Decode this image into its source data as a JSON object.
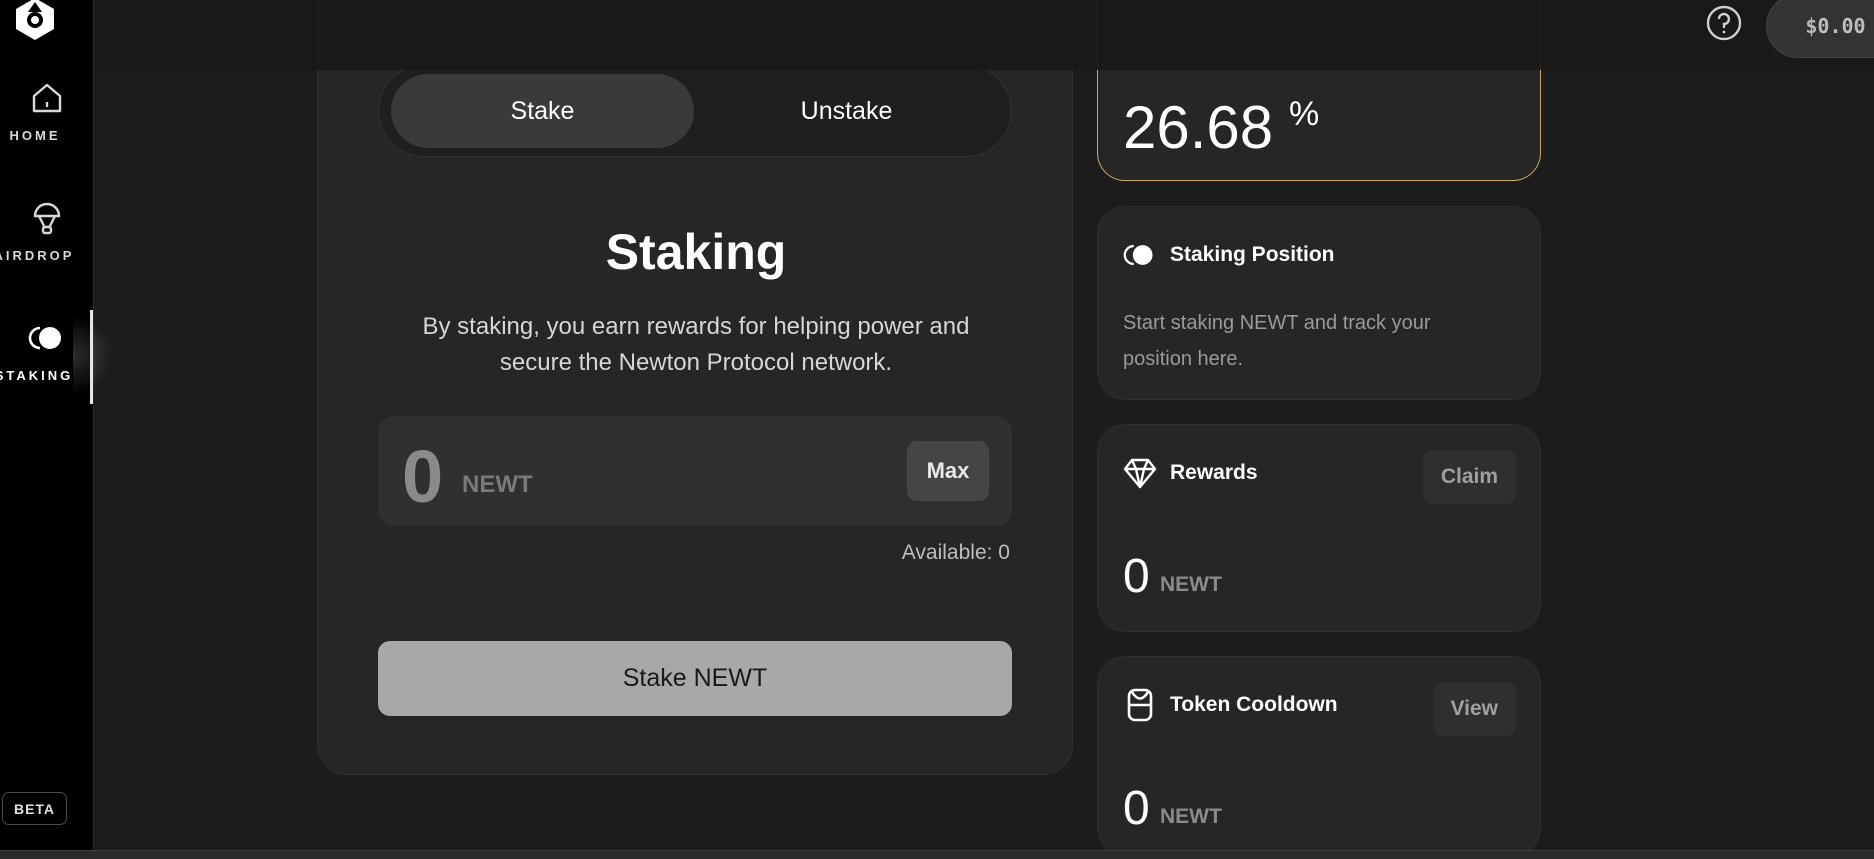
{
  "sidebar": {
    "items": [
      {
        "label": "HOME",
        "icon": "home-icon"
      },
      {
        "label": "AIRDROP",
        "icon": "parachute-icon"
      },
      {
        "label": "STAKING",
        "icon": "staking-icon"
      }
    ],
    "active": "STAKING",
    "beta_label": "BETA"
  },
  "topbar": {
    "wallet_balance": "$0.00",
    "help_icon": "question-circle-icon",
    "wallet_icon": "wallet-icon"
  },
  "stake_panel": {
    "tabs": [
      {
        "label": "Stake",
        "active": true
      },
      {
        "label": "Unstake",
        "active": false
      }
    ],
    "title": "Staking",
    "description": "By staking, you earn rewards for helping power and secure the Newton Protocol network.",
    "amount_value": "0",
    "amount_unit": "NEWT",
    "max_label": "Max",
    "available_text": "Available: 0",
    "stake_button_label": "Stake NEWT"
  },
  "apr_card": {
    "value": "26.68",
    "unit": "%",
    "accent_color": "#c9a66b"
  },
  "position_card": {
    "title": "Staking Position",
    "icon": "staking-icon",
    "text": "Start staking NEWT and track your position here."
  },
  "rewards_card": {
    "title": "Rewards",
    "icon": "diamond-icon",
    "action_label": "Claim",
    "value": "0",
    "unit": "NEWT"
  },
  "cooldown_card": {
    "title": "Token Cooldown",
    "icon": "hourglass-icon",
    "action_label": "View",
    "value": "0",
    "unit": "NEWT"
  }
}
